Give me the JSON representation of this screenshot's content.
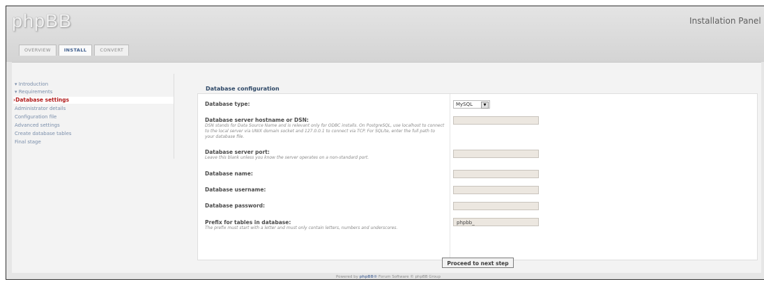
{
  "header": {
    "logo": "phpBB",
    "panel_title": "Installation Panel"
  },
  "tabs": [
    {
      "label": "OVERVIEW",
      "active": false
    },
    {
      "label": "INSTALL",
      "active": true
    },
    {
      "label": "CONVERT",
      "active": false
    }
  ],
  "sidebar": {
    "items": [
      {
        "label": "▾ Introduction"
      },
      {
        "label": "▾ Requirements"
      },
      {
        "label": "›Database settings",
        "current": true
      },
      {
        "label": "Administrator details"
      },
      {
        "label": "Configuration file"
      },
      {
        "label": "Advanced settings"
      },
      {
        "label": "Create database tables"
      },
      {
        "label": "Final stage"
      }
    ]
  },
  "form": {
    "section_title": "Database configuration",
    "db_type": {
      "label": "Database type:",
      "value": "MySQL"
    },
    "hostname": {
      "label": "Database server hostname or DSN:",
      "description": "DSN stands for Data Source Name and is relevant only for ODBC installs. On PostgreSQL, use localhost to connect to the local server via UNIX domain socket and 127.0.0.1 to connect via TCP. For SQLite, enter the full path to your database file.",
      "value": ""
    },
    "port": {
      "label": "Database server port:",
      "description": "Leave this blank unless you know the server operates on a non-standard port.",
      "value": ""
    },
    "name": {
      "label": "Database name:",
      "value": ""
    },
    "username": {
      "label": "Database username:",
      "value": ""
    },
    "password": {
      "label": "Database password:",
      "value": ""
    },
    "prefix": {
      "label": "Prefix for tables in database:",
      "description": "The prefix must start with a letter and must only contain letters, numbers and underscores.",
      "value": "phpbb_"
    },
    "submit_label": "Proceed to next step"
  },
  "footer": {
    "prefix": "Powered by ",
    "brand": "phpBB®",
    "suffix": " Forum Software © phpBB Group"
  }
}
